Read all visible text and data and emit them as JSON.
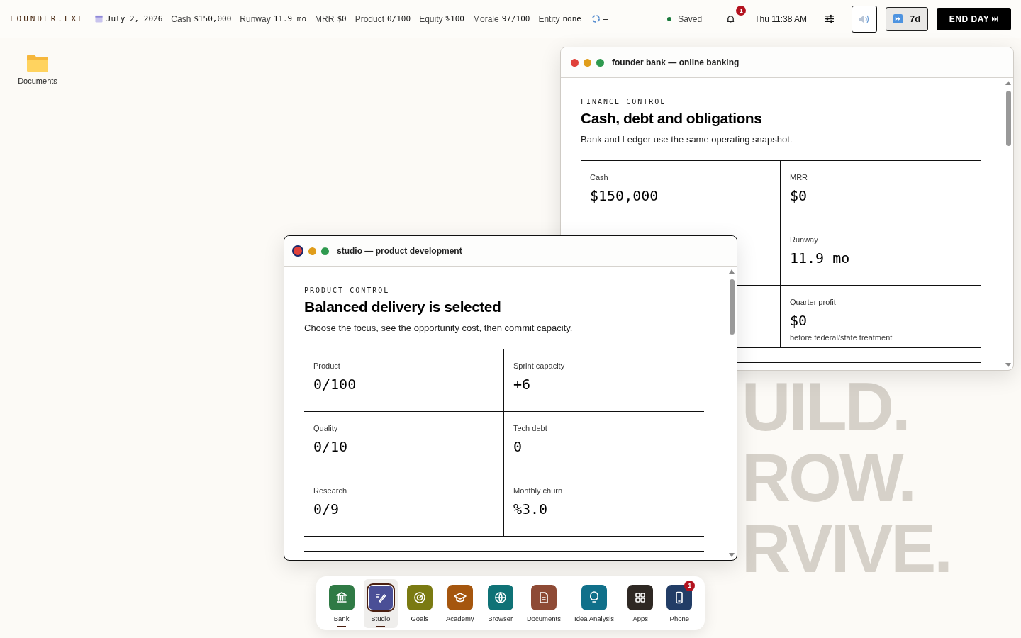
{
  "topbar": {
    "brand": "FOUNDER.EXE",
    "date": "July 2, 2026",
    "stats": [
      {
        "label": "Cash",
        "value": "$150,000"
      },
      {
        "label": "Runway",
        "value": "11.9 mo"
      },
      {
        "label": "MRR",
        "value": "$0"
      },
      {
        "label": "Product",
        "value": "0/100"
      },
      {
        "label": "Equity",
        "value": "%100"
      },
      {
        "label": "Morale",
        "value": "97/100"
      },
      {
        "label": "Entity",
        "value": "none"
      }
    ],
    "sync": "–",
    "save_status": "Saved",
    "notifications": "1",
    "clock": "Thu 11:38 AM",
    "speed": "7d",
    "end_day": "END DAY"
  },
  "desktop": {
    "icons": [
      {
        "label": "Documents"
      }
    ],
    "wallpaper": [
      "UILD.",
      "ROW.",
      "RVIVE."
    ]
  },
  "windows": [
    {
      "title": "founder bank — online banking",
      "active": false,
      "eyebrow": "FINANCE CONTROL",
      "heading": "Cash, debt and obligations",
      "subtitle": "Bank and Ledger use the same operating snapshot.",
      "rows": [
        {
          "left": {
            "label": "Cash",
            "value": "$150,000"
          },
          "right": {
            "label": "MRR",
            "value": "$0"
          }
        },
        {
          "right": {
            "label": "Runway",
            "value": "11.9 mo"
          }
        },
        {
          "right": {
            "label": "Quarter profit",
            "value": "$0",
            "note": "before federal/state treatment"
          }
        }
      ]
    },
    {
      "title": "studio — product development",
      "active": true,
      "eyebrow": "PRODUCT CONTROL",
      "heading": "Balanced delivery is selected",
      "subtitle": "Choose the focus, see the opportunity cost, then commit capacity.",
      "rows": [
        {
          "left": {
            "label": "Product",
            "value": "0/100"
          },
          "right": {
            "label": "Sprint capacity",
            "value": "+6"
          }
        },
        {
          "left": {
            "label": "Quality",
            "value": "0/10"
          },
          "right": {
            "label": "Tech debt",
            "value": "0"
          }
        },
        {
          "left": {
            "label": "Research",
            "value": "0/9"
          },
          "right": {
            "label": "Monthly churn",
            "value": "%3.0"
          }
        }
      ]
    }
  ],
  "dock": [
    {
      "kind": "bank",
      "label": "Bank",
      "color": "#2f7a45",
      "selected": false,
      "running": true
    },
    {
      "kind": "studio",
      "label": "Studio",
      "color": "#4a4f96",
      "selected": true,
      "running": true
    },
    {
      "kind": "goals",
      "label": "Goals",
      "color": "#7a7a12",
      "selected": false,
      "running": false
    },
    {
      "kind": "academy",
      "label": "Academy",
      "color": "#a5560e",
      "selected": false,
      "running": false
    },
    {
      "kind": "browser",
      "label": "Browser",
      "color": "#0f7276",
      "selected": false,
      "running": false
    },
    {
      "kind": "documents",
      "label": "Documents",
      "color": "#8e4a35",
      "selected": false,
      "running": false
    },
    {
      "kind": "idea",
      "label": "Idea Analysis",
      "color": "#10708a",
      "selected": false,
      "running": false
    },
    {
      "kind": "apps",
      "label": "Apps",
      "color": "#2e2823",
      "selected": false,
      "running": false
    },
    {
      "kind": "phone",
      "label": "Phone",
      "color": "#223d66",
      "selected": false,
      "running": false,
      "badge": "1"
    }
  ]
}
